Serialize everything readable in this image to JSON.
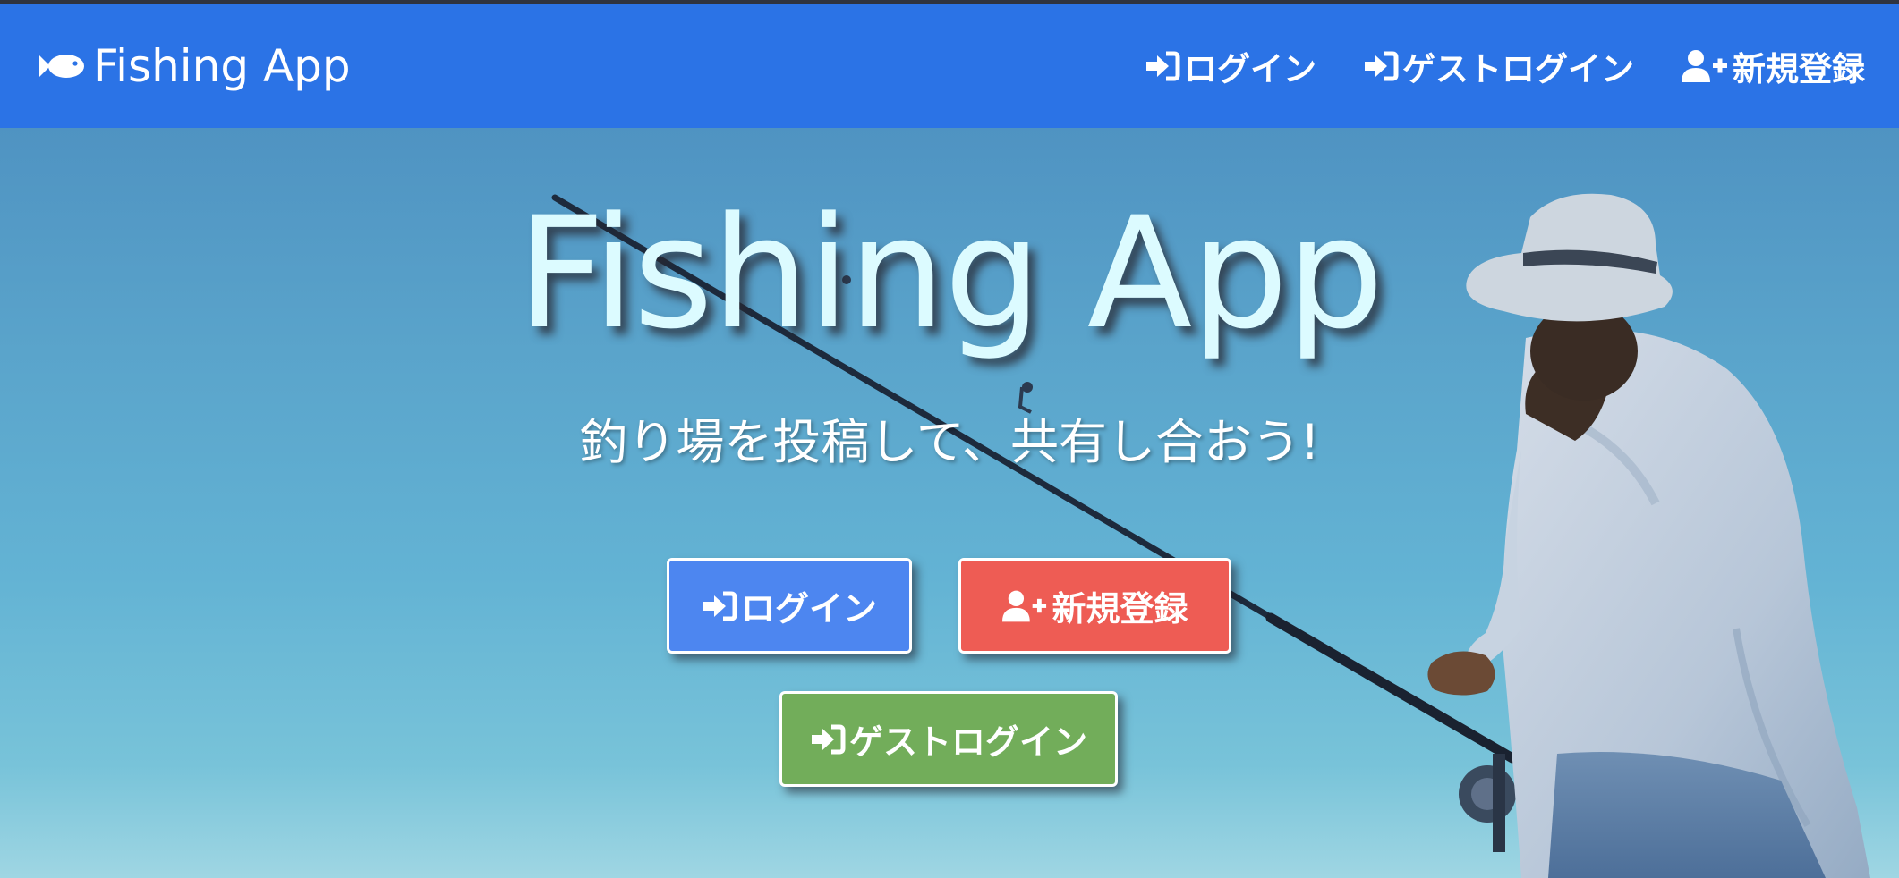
{
  "navbar": {
    "brand": "Fishing App",
    "brand_icon": "fish-icon",
    "background": "#2b73e6",
    "links": {
      "login": "ログイン",
      "guest_login": "ゲストログイン",
      "signup": "新規登録"
    }
  },
  "hero": {
    "title": "Fishing App",
    "subtitle": "釣り場を投稿して、共有し合おう!",
    "buttons": {
      "login": "ログイン",
      "signup": "新規登録",
      "guest_login": "ゲストログイン"
    }
  },
  "colors": {
    "login_button": "#4d86f0",
    "signup_button": "#ee5c54",
    "guest_button": "#72ad5a",
    "title_text": "#dcfbff"
  },
  "icons": {
    "login": "sign-in-icon",
    "signup": "user-plus-icon"
  }
}
